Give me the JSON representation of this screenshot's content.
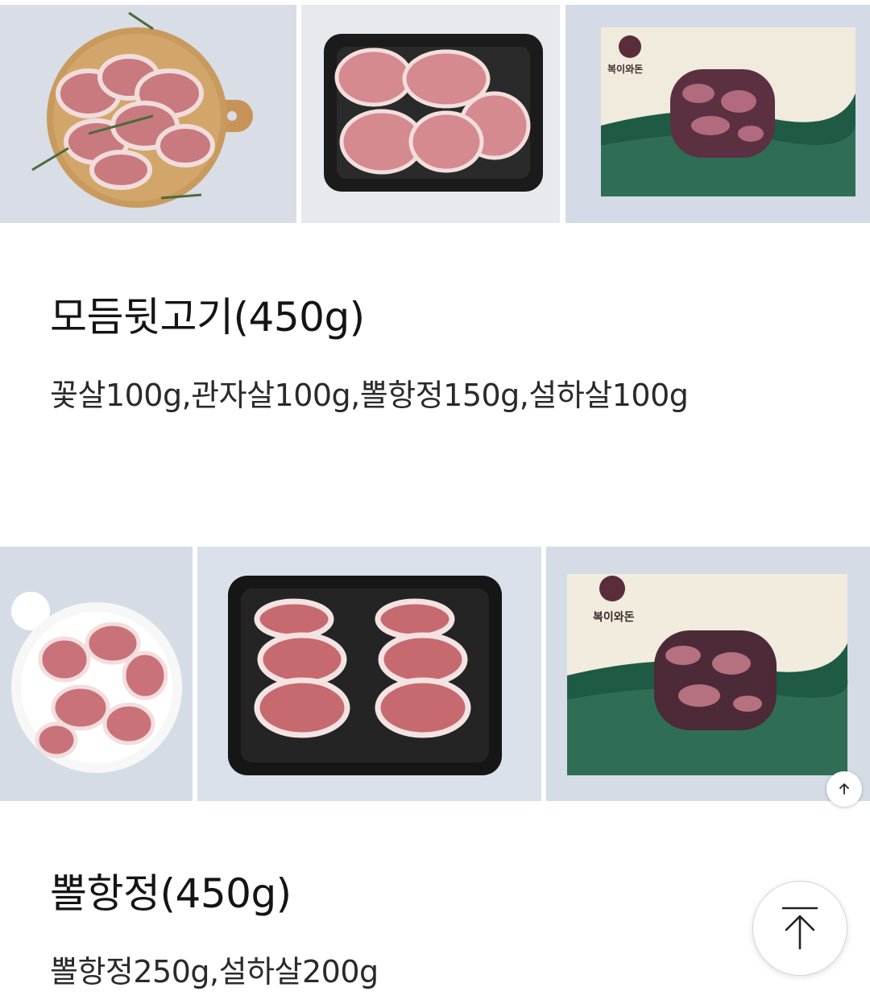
{
  "products": [
    {
      "title": "모듬뒷고기(450g)",
      "description": "꽃살100g,관자살100g,뽈항정150g,설하살100g",
      "photos": [
        {
          "icon": "meat-on-cutting-board-photo"
        },
        {
          "icon": "meat-in-black-tray-photo"
        },
        {
          "icon": "gift-box-photo",
          "brand_text": "복이와돈"
        }
      ]
    },
    {
      "title": "뽈항정(450g)",
      "description": "뽈항정250g,설하살200g",
      "photos": [
        {
          "icon": "meat-on-white-plate-photo"
        },
        {
          "icon": "meat-in-black-tray-photo"
        },
        {
          "icon": "gift-box-photo",
          "brand_text": "복이와돈"
        }
      ]
    }
  ],
  "buttons": {
    "scroll_up_small": {
      "icon": "arrow-up-icon"
    },
    "scroll_to_top": {
      "icon": "arrow-to-top-icon"
    }
  },
  "colors": {
    "background": "#ffffff",
    "photo_background": "#d9dee6",
    "box_green": "#1f5a44",
    "box_cream": "#efe9d8",
    "meat_red": "#b9535a"
  }
}
